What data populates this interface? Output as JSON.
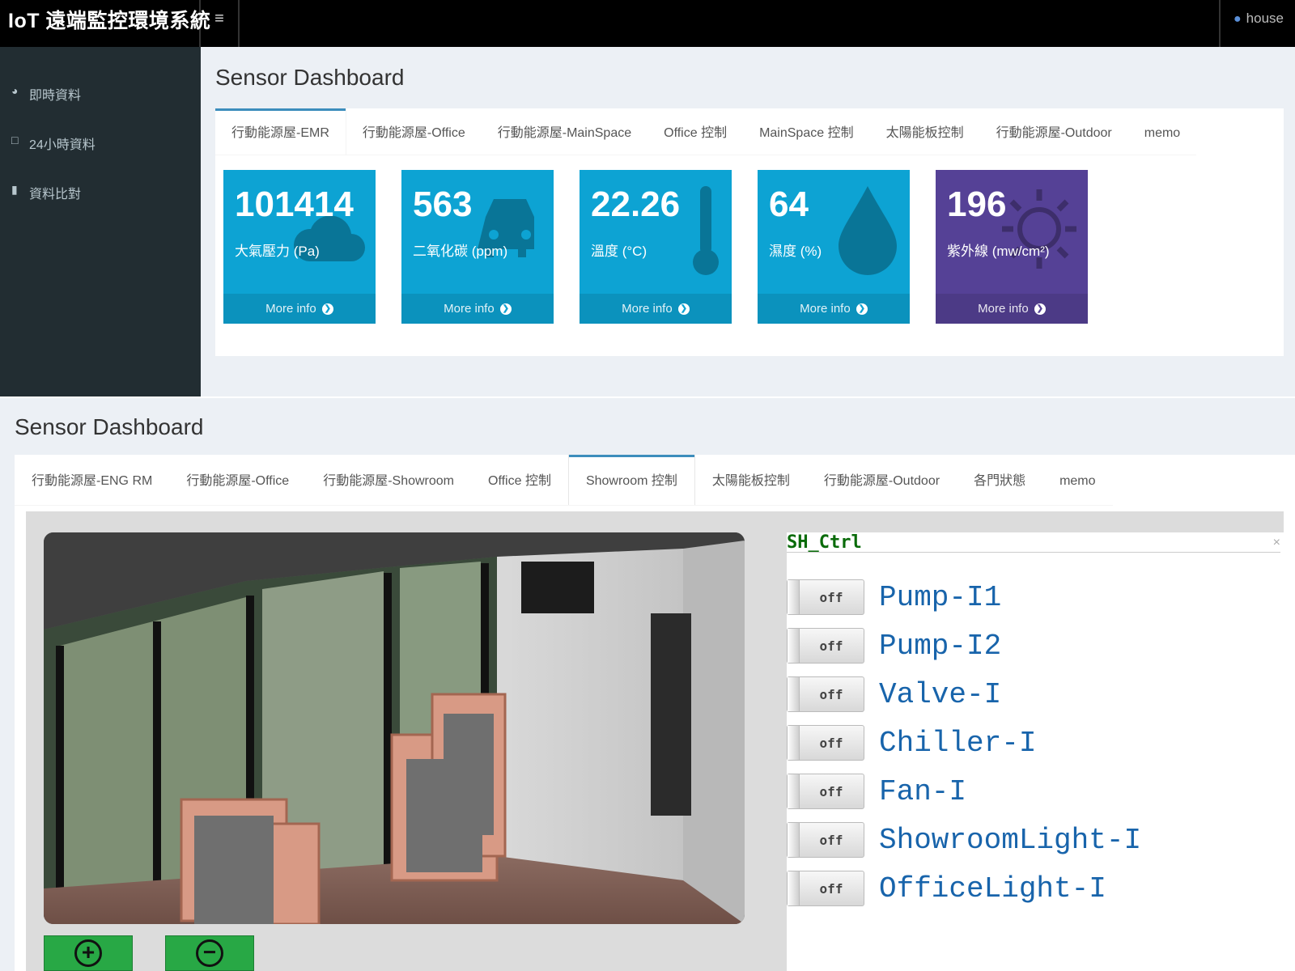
{
  "top": {
    "brand": "IoT 遠端監控環境系統",
    "menu_icon": "hamburger-icon",
    "user": "house",
    "sidebar": [
      {
        "label": "即時資料",
        "icon": "dashboard-icon"
      },
      {
        "label": "24小時資料",
        "icon": "book-icon"
      },
      {
        "label": "資料比對",
        "icon": "bar-chart-icon"
      }
    ],
    "title": "Sensor Dashboard",
    "tabs": [
      "行動能源屋-EMR",
      "行動能源屋-Office",
      "行動能源屋-MainSpace",
      "Office 控制",
      "MainSpace 控制",
      "太陽能板控制",
      "行動能源屋-Outdoor",
      "memo"
    ],
    "active_tab": 0,
    "boxes": [
      {
        "value": "101414",
        "label": "大氣壓力 (Pa)",
        "icon": "cloud-icon",
        "color": "#0da3d3",
        "footer": "More info"
      },
      {
        "value": "563",
        "label": "二氧化碳 (ppm)",
        "icon": "car-icon",
        "color": "#0da3d3",
        "footer": "More info"
      },
      {
        "value": "22.26",
        "label": "溫度 (°C)",
        "icon": "thermometer-icon",
        "color": "#0da3d3",
        "footer": "More info"
      },
      {
        "value": "64",
        "label": "濕度 (%)",
        "icon": "droplet-icon",
        "color": "#0da3d3",
        "footer": "More info"
      },
      {
        "value": "196",
        "label": "紫外線 (mw/cm²)",
        "icon": "sun-icon",
        "color": "#554196",
        "footer": "More info"
      }
    ]
  },
  "bottom": {
    "title": "Sensor Dashboard",
    "tabs": [
      "行動能源屋-ENG RM",
      "行動能源屋-Office",
      "行動能源屋-Showroom",
      "Office 控制",
      "Showroom 控制",
      "太陽能板控制",
      "行動能源屋-Outdoor",
      "各門狀態",
      "memo"
    ],
    "active_tab": 4,
    "camera": {
      "zoom_in": "+",
      "zoom_out": "−"
    },
    "control": {
      "title": "SH_Ctrl",
      "close": "×",
      "devices": [
        {
          "state": "off",
          "label": "Pump-I1"
        },
        {
          "state": "off",
          "label": "Pump-I2"
        },
        {
          "state": "off",
          "label": "Valve-I"
        },
        {
          "state": "off",
          "label": "Chiller-I"
        },
        {
          "state": "off",
          "label": "Fan-I"
        },
        {
          "state": "off",
          "label": "ShowroomLight-I"
        },
        {
          "state": "off",
          "label": "OfficeLight-I"
        }
      ]
    }
  }
}
